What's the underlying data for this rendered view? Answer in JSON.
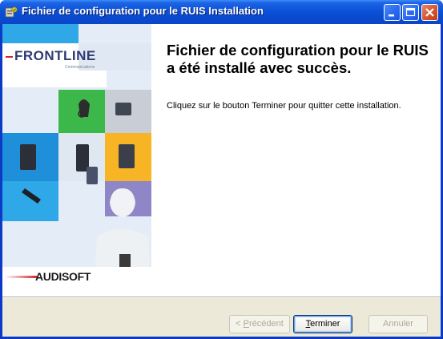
{
  "window": {
    "title": "Fichier de configuration pour le RUIS Installation",
    "icon": "installer-icon"
  },
  "banner": {
    "frontline_logo": "FRONTLINE",
    "frontline_sub": "Communications",
    "audisoft_logo": "AUDISOFT"
  },
  "content": {
    "heading": "Fichier de configuration pour le RUIS a été installé avec succès.",
    "message": "Cliquez sur le bouton Terminer pour quitter cette installation."
  },
  "buttons": {
    "prev": {
      "label": "< Précédent",
      "prefix": "< ",
      "mnemonic": "P",
      "rest": "récédent",
      "enabled": false
    },
    "finish": {
      "label": "Terminer",
      "mnemonic": "T",
      "rest": "erminer",
      "enabled": true,
      "default": true
    },
    "cancel": {
      "label": "Annuler",
      "enabled": false
    }
  },
  "colors": {
    "titlebar": "#0b52d6",
    "close_button": "#c23b14",
    "footer": "#ece9d8"
  }
}
